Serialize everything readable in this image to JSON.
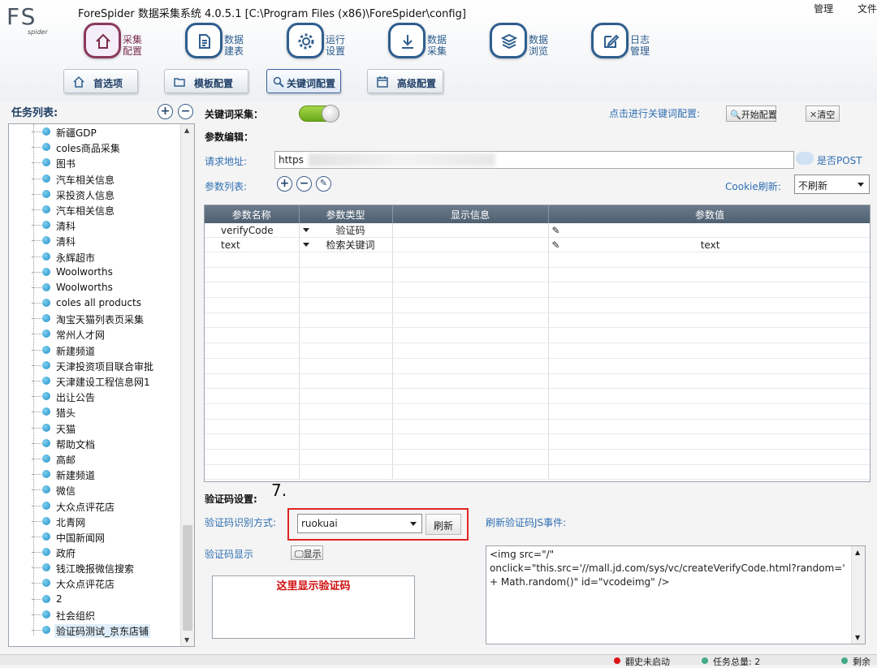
{
  "app": {
    "logo_text": "FS",
    "logo_sub": "spider",
    "title": "ForeSpider 数据采集系统  4.0.5.1  [C:\\Program Files (x86)\\ForeSpider\\config]",
    "top_right": [
      "管理",
      "文件"
    ]
  },
  "nav": [
    {
      "label1": "采集",
      "label2": "配置",
      "icon": "home-icon"
    },
    {
      "label1": "数据",
      "label2": "建表",
      "icon": "document-icon"
    },
    {
      "label1": "运行",
      "label2": "设置",
      "icon": "gear-icon"
    },
    {
      "label1": "数据",
      "label2": "采集",
      "icon": "download-icon"
    },
    {
      "label1": "数据",
      "label2": "浏览",
      "icon": "layers-icon"
    },
    {
      "label1": "日志",
      "label2": "管理",
      "icon": "edit-icon"
    }
  ],
  "subtabs": [
    {
      "label": "首选项",
      "icon": "home-icon"
    },
    {
      "label": "模板配置",
      "icon": "folder-icon"
    },
    {
      "label": "关键词配置",
      "icon": "search-icon"
    },
    {
      "label": "高级配置",
      "icon": "calendar-icon"
    }
  ],
  "task_list": {
    "title": "任务列表:",
    "add": "+",
    "remove": "−",
    "items": [
      "新疆GDP",
      "coles商品采集",
      "图书",
      "汽车相关信息",
      "采投资人信息",
      "汽车相关信息",
      "清科",
      "清科",
      "永辉超市",
      "Woolworths",
      "Woolworths",
      "coles all products",
      "淘宝天猫列表页采集",
      "常州人才网",
      "新建频道",
      "天津投资项目联合审批",
      "天津建设工程信息网1",
      "出让公告",
      "猎头",
      "天猫",
      "帮助文档",
      "高邮",
      "新建频道",
      "微信",
      "大众点评花店",
      "北青网",
      "中国新闻网",
      "政府",
      "钱江晚报微信搜索",
      "大众点评花店",
      "2",
      "社会组织",
      "验证码测试_京东店铺"
    ]
  },
  "keyword": {
    "label": "关键词采集：",
    "config_hint": "点击进行关键词配置:",
    "start_btn": "开始配置",
    "clear_btn": "清空",
    "param_edit": "参数编辑：",
    "url_label": "请求地址:",
    "url_value": "https",
    "post_label": "是否POST",
    "param_list": "参数列表:",
    "cookie_label": "Cookie刷新:",
    "cookie_value": "不刷新"
  },
  "param_table": {
    "headers": [
      "参数名称",
      "参数类型",
      "显示信息",
      "参数值"
    ],
    "rows": [
      {
        "name": "verifyCode",
        "type": "验证码",
        "display": "",
        "value": ""
      },
      {
        "name": "text",
        "type": "检索关键词",
        "display": "",
        "value": "text"
      }
    ]
  },
  "captcha": {
    "section": "验证码设置:",
    "step": "7.",
    "method_label": "验证码识别方式:",
    "method_value": "ruokuai",
    "refresh": "刷新",
    "js_label": "刷新验证码JS事件:",
    "display_label": "验证码显示",
    "display_btn": "显示",
    "placeholder": "这里显示验证码",
    "js_code": "<img src=\"/\" onclick=\"this.src='//mall.jd.com/sys/vc/createVerifyCode.html?random=' + Math.random()\" id=\"vcodeimg\" />"
  },
  "status": {
    "a": "翻史未启动",
    "b": "任务总量: 2",
    "c": "剩余"
  }
}
